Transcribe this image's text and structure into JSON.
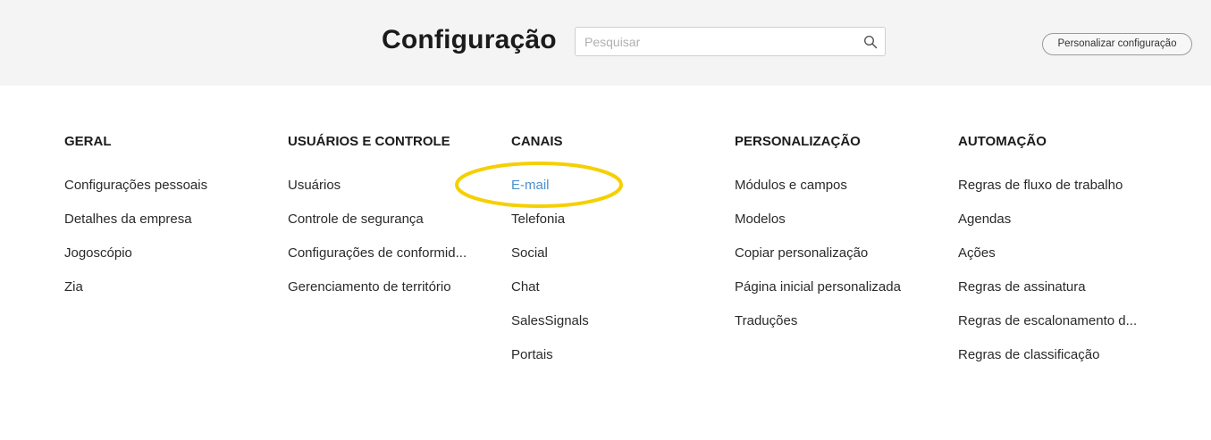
{
  "header": {
    "title": "Configuração",
    "search": {
      "placeholder": "Pesquisar",
      "value": ""
    },
    "customize_label": "Personalizar configuração"
  },
  "columns": [
    {
      "heading": "GERAL",
      "items": [
        "Configurações pessoais",
        "Detalhes da empresa",
        "Jogoscópio",
        "Zia"
      ]
    },
    {
      "heading": "USUÁRIOS E CONTROLE",
      "items": [
        "Usuários",
        "Controle de segurança",
        "Configurações de conformid...",
        "Gerenciamento de território"
      ]
    },
    {
      "heading": "CANAIS",
      "items": [
        "E-mail",
        "Telefonia",
        "Social",
        "Chat",
        "SalesSignals",
        "Portais"
      ]
    },
    {
      "heading": "PERSONALIZAÇÃO",
      "items": [
        "Módulos e campos",
        "Modelos",
        "Copiar personalização",
        "Página inicial personalizada",
        "Traduções"
      ]
    },
    {
      "heading": "AUTOMAÇÃO",
      "items": [
        "Regras de fluxo de trabalho",
        "Agendas",
        "Ações",
        "Regras de assinatura",
        "Regras de escalonamento d...",
        "Regras de classificação"
      ]
    }
  ],
  "colors": {
    "header_bg": "#f4f4f4",
    "link_highlight": "#4a90d0",
    "annotation": "#f5d000"
  },
  "icons": {
    "search": "search-icon"
  }
}
